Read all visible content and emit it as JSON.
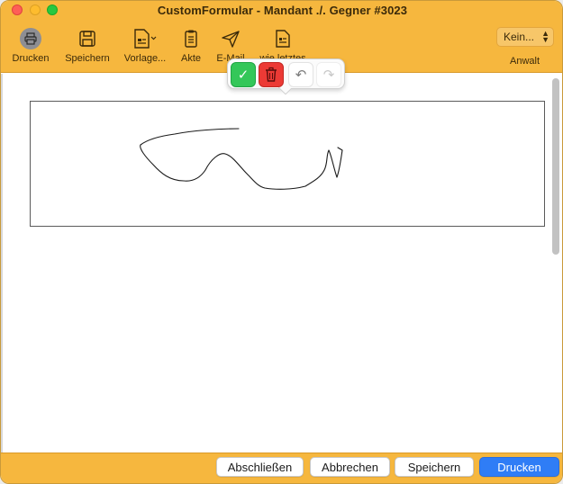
{
  "window": {
    "title": "CustomFormular -  Mandant ./. Gegner #3023"
  },
  "toolbar": {
    "items": [
      {
        "label": "Drucken",
        "icon": "printer-icon"
      },
      {
        "label": "Speichern",
        "icon": "save-icon"
      },
      {
        "label": "Vorlage...",
        "icon": "template-icon"
      },
      {
        "label": "Akte",
        "icon": "clipboard-icon"
      },
      {
        "label": "E-Mail",
        "icon": "paper-plane-icon"
      },
      {
        "label": "wie letztes",
        "icon": "document-icon"
      }
    ],
    "party_select": {
      "value": "Kein..."
    },
    "party_label": "Anwalt"
  },
  "signature_popover": {
    "accept_symbol": "✓",
    "undo_symbol": "↶",
    "redo_symbol": "↷",
    "accept_color": "#34c759",
    "delete_color": "#ec3a35"
  },
  "footer": {
    "buttons": {
      "close": "Abschließen",
      "cancel": "Abbrechen",
      "save": "Speichern",
      "print": "Drucken"
    }
  },
  "colors": {
    "accent": "#f6b73e",
    "primary_button": "#2f7df6"
  }
}
